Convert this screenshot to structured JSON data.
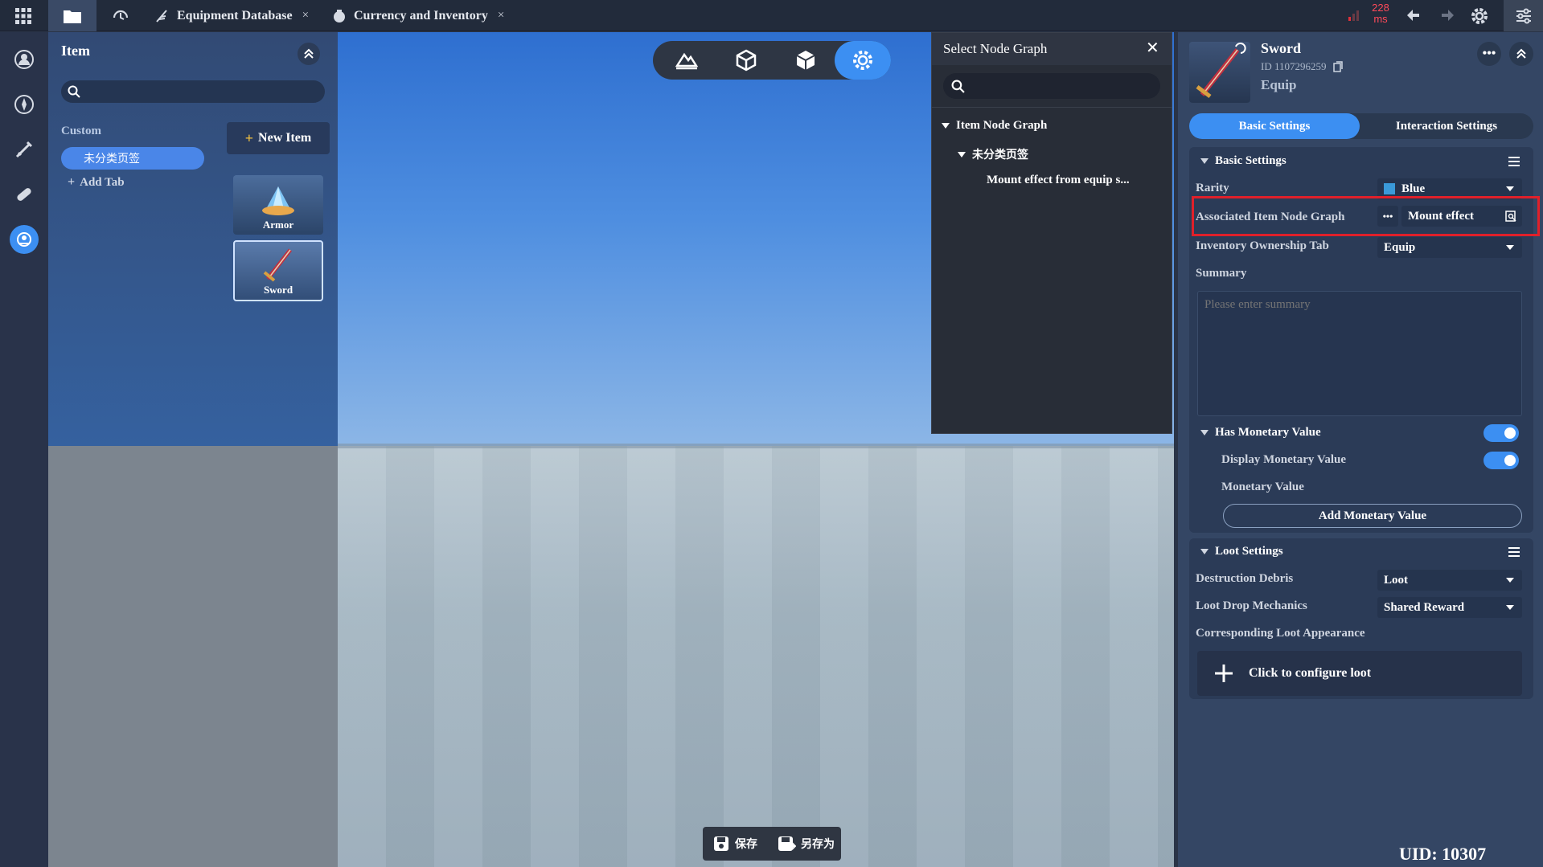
{
  "topbar": {
    "tabs": [
      {
        "label": "Equipment Database",
        "close": "×"
      },
      {
        "label": "Currency and Inventory",
        "close": "×"
      }
    ],
    "latency_value": "228",
    "latency_unit": "ms"
  },
  "item_panel": {
    "title": "Item",
    "search_placeholder": "",
    "custom_label": "Custom",
    "tab_selected": "未分类页签",
    "add_tab": "Add Tab",
    "new_item": "New Item",
    "items": [
      {
        "name": "Armor"
      },
      {
        "name": "Sword"
      }
    ]
  },
  "node_popup": {
    "title": "Select Node Graph",
    "close": "✕",
    "tree_root": "Item Node Graph",
    "tree_child": "未分类页签",
    "tree_leaf": "Mount effect from equip s..."
  },
  "detail": {
    "name": "Sword",
    "id": "ID 1107296259",
    "category": "Equip",
    "tabs": {
      "basic": "Basic Settings",
      "interaction": "Interaction Settings"
    },
    "basic_section": "Basic Settings",
    "rarity_label": "Rarity",
    "rarity_value": "Blue",
    "rarity_color": "#3a9ad9",
    "node_graph_label": "Associated Item Node Graph",
    "node_graph_value": "Mount effect",
    "ownership_label": "Inventory Ownership Tab",
    "ownership_value": "Equip",
    "summary_label": "Summary",
    "summary_placeholder": "Please enter summary",
    "monetary_section": "Has Monetary Value",
    "display_monetary": "Display Monetary Value",
    "monetary_value_label": "Monetary Value",
    "add_monetary": "Add Monetary Value",
    "loot_section": "Loot Settings",
    "debris_label": "Destruction Debris",
    "debris_value": "Loot",
    "drop_label": "Loot Drop Mechanics",
    "drop_value": "Shared Reward",
    "appearance_label": "Corresponding Loot Appearance",
    "configure_loot": "Click to configure loot"
  },
  "bottom": {
    "save": "保存",
    "save_as": "另存为",
    "uid": "UID: 10307"
  },
  "colors": {
    "accent": "#3c8ff2",
    "highlight": "#e0202a"
  }
}
